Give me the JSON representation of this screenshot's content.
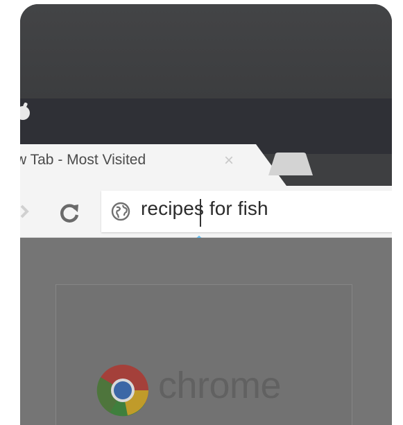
{
  "tab": {
    "title": "w Tab - Most Visited",
    "close_glyph": "×"
  },
  "omnibox": {
    "text": "recipes for fish",
    "typed_display": "recipes for fish"
  },
  "content": {
    "wordmark": "chrome"
  },
  "icons": {
    "status": "notification-icon",
    "back": "back-arrow-icon",
    "reload": "reload-icon",
    "site": "globe-icon",
    "handle": "selection-handle-icon",
    "logo": "chrome-logo-icon"
  },
  "colors": {
    "handle": "#3fa7e3",
    "tab_strip": "#2f3036",
    "toolbar": "#f4f4f4",
    "content": "#757575"
  }
}
